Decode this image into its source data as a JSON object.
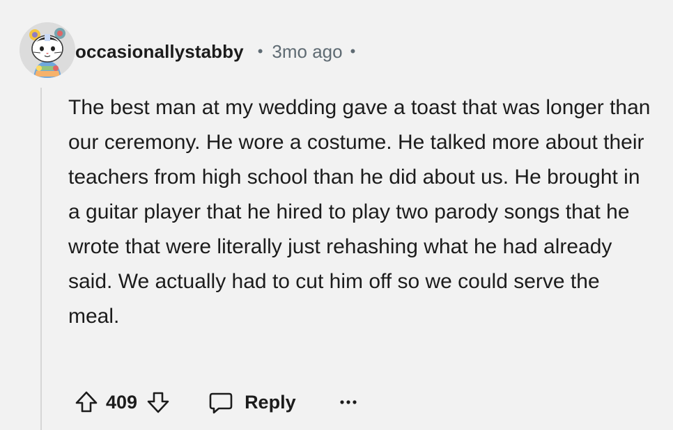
{
  "comment": {
    "username": "occasionallystabby",
    "separator": "•",
    "timestamp": "3mo ago",
    "trailing_separator": "•",
    "body": "The best man at my wedding gave a toast that was longer than our ceremony. He wore a costume. He talked more about their teachers from high school than he did about us. He brought in a guitar player that he hired to play two parody songs that he wrote that were literally just rehashing what he had already said. We actually had to cut him off so we could serve the meal.",
    "score": "409",
    "reply_label": "Reply",
    "icons": {
      "upvote": "upvote-arrow-icon",
      "downvote": "downvote-arrow-icon",
      "reply": "speech-bubble-icon",
      "more": "more-options-icon"
    }
  },
  "colors": {
    "background": "#f2f2f2",
    "text": "#1c1c1c",
    "meta": "#5f6b73",
    "thread_line": "#d6d6d6"
  }
}
